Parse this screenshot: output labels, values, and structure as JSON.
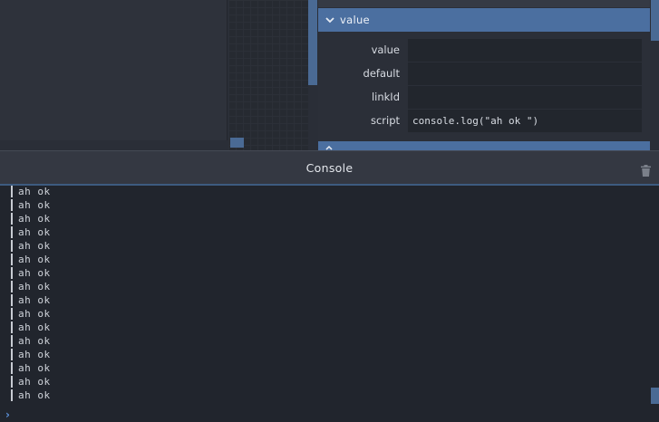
{
  "properties": {
    "section_title": "value",
    "rows": [
      {
        "label": "value",
        "value": ""
      },
      {
        "label": "default",
        "value": ""
      },
      {
        "label": "linkId",
        "value": ""
      },
      {
        "label": "script",
        "value": "console.log(\"ah ok \")"
      }
    ]
  },
  "console": {
    "title": "Console",
    "clear_icon": "trash-icon",
    "prompt_icon": "chevron-right-icon",
    "lines": [
      "ah ok",
      "ah ok",
      "ah ok",
      "ah ok",
      "ah ok",
      "ah ok",
      "ah ok",
      "ah ok",
      "ah ok",
      "ah ok",
      "ah ok",
      "ah ok",
      "ah ok",
      "ah ok",
      "ah ok",
      "ah ok"
    ]
  },
  "colors": {
    "accent": "#4b6fa0",
    "background": "#21252d",
    "panel": "#2b2f38",
    "prompt_caret": "#5b8fd6"
  }
}
